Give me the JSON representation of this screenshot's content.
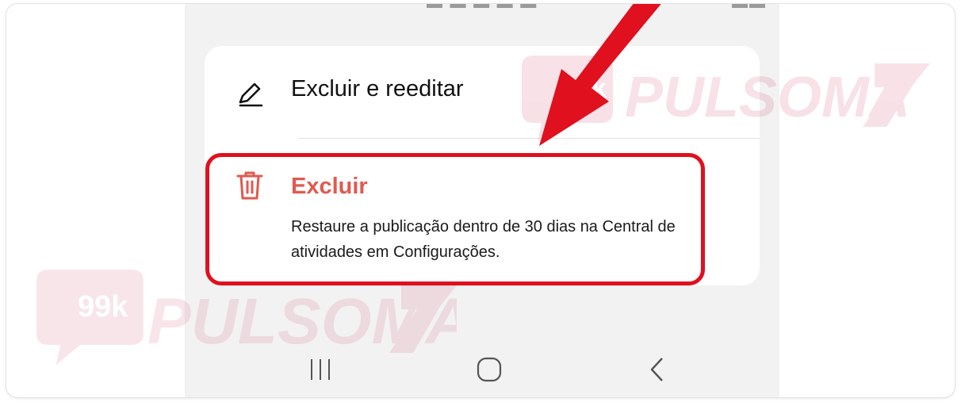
{
  "sheet": {
    "edit_option": {
      "label": "Excluir e reeditar",
      "icon": "pencil-icon"
    },
    "delete_option": {
      "label": "Excluir",
      "icon": "trash-icon",
      "description": "Restaure a publicação dentro de 30 dias na Central de atividades em Configurações."
    }
  },
  "watermark": {
    "brand_text": "PULSOMA",
    "badge_text": "99k"
  },
  "navbar": {
    "recent_apps_icon": "recent-apps-icon",
    "home_icon": "home-icon",
    "back_icon": "back-icon"
  },
  "colors": {
    "delete_accent": "#e05a4f",
    "highlight": "#e0101e",
    "arrow": "#e0101e",
    "background": "#f2f2f2"
  }
}
